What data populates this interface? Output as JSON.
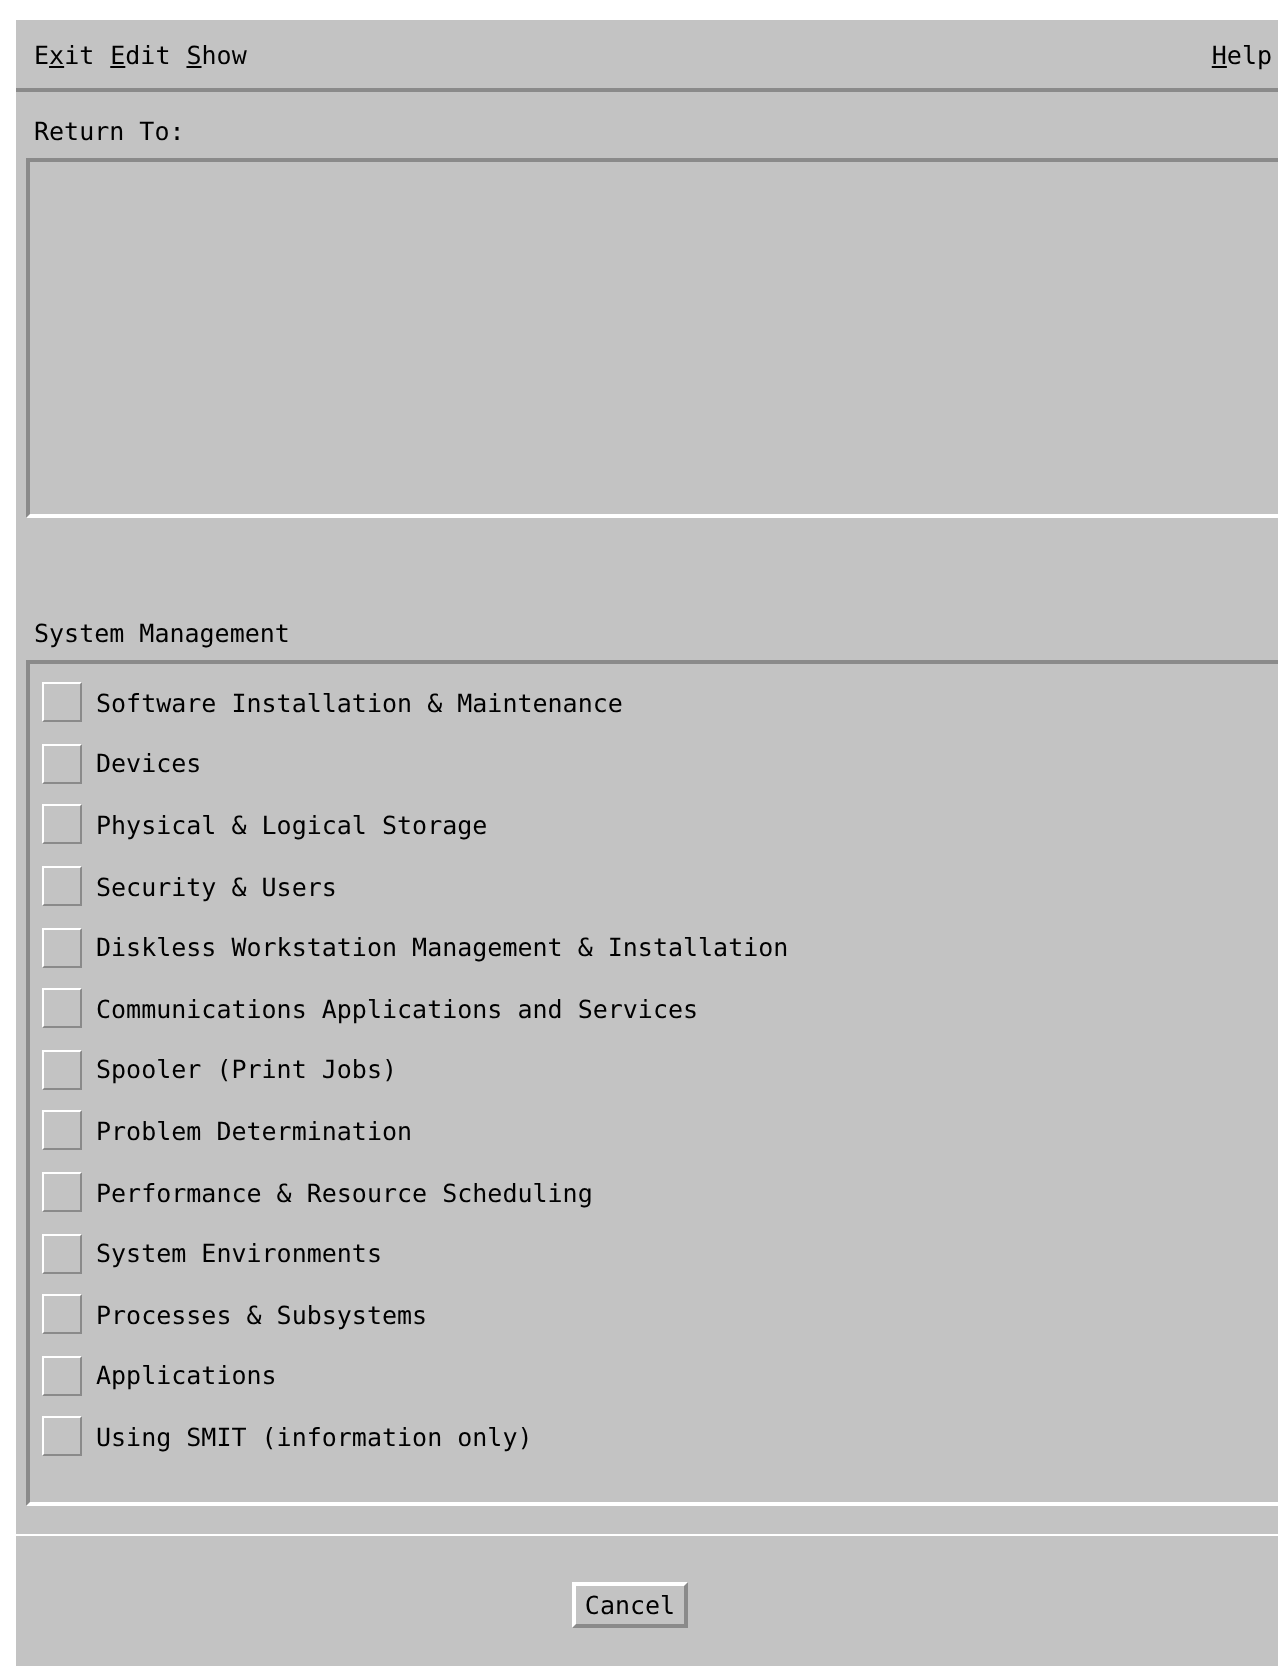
{
  "menu_bar": {
    "left": [
      {
        "pre": "E",
        "key": "x",
        "post": "it"
      },
      {
        "key": "E",
        "post": "dit"
      },
      {
        "key": "S",
        "post": "how"
      }
    ],
    "right": [
      {
        "key": "H",
        "post": "elp"
      }
    ]
  },
  "return_to": {
    "label": "Return To:"
  },
  "system_management": {
    "label": "System Management",
    "items": [
      {
        "label": "Software Installation & Maintenance",
        "checked": false
      },
      {
        "label": "Devices",
        "checked": false
      },
      {
        "label": "Physical & Logical Storage",
        "checked": false
      },
      {
        "label": "Security & Users",
        "checked": false
      },
      {
        "label": "Diskless Workstation Management & Installation",
        "checked": false
      },
      {
        "label": "Communications Applications and Services",
        "checked": false
      },
      {
        "label": "Spooler (Print Jobs)",
        "checked": false
      },
      {
        "label": "Problem Determination",
        "checked": false
      },
      {
        "label": "Performance & Resource Scheduling",
        "checked": false
      },
      {
        "label": "System Environments",
        "checked": false
      },
      {
        "label": "Processes & Subsystems",
        "checked": false
      },
      {
        "label": "Applications",
        "checked": false
      },
      {
        "label": "Using SMIT (information only)",
        "checked": false
      }
    ]
  },
  "buttons": [
    "Cancel"
  ]
}
